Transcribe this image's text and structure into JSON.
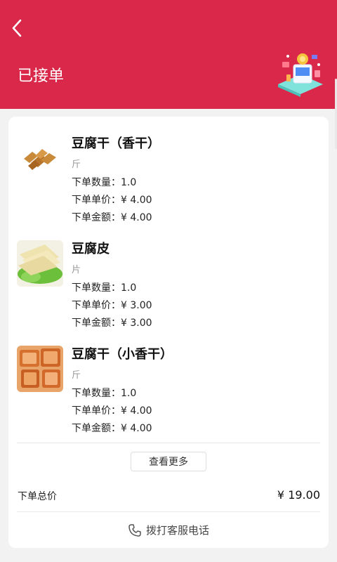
{
  "header": {
    "title": "已接单",
    "bg_color": "#d9284a",
    "back_icon": "chevron-left-icon"
  },
  "products": [
    {
      "name": "豆腐干（香干）",
      "unit": "斤",
      "qty_label": "下单数量：",
      "qty": "1.0",
      "price_label": "下单单价：",
      "price": "¥ 4.00",
      "amount_label": "下单金额：",
      "amount": "¥ 4.00"
    },
    {
      "name": "豆腐皮",
      "unit": "片",
      "qty_label": "下单数量：",
      "qty": "1.0",
      "price_label": "下单单价：",
      "price": "¥ 3.00",
      "amount_label": "下单金额：",
      "amount": "¥ 3.00"
    },
    {
      "name": "豆腐干（小香干）",
      "unit": "斤",
      "qty_label": "下单数量：",
      "qty": "1.0",
      "price_label": "下单单价：",
      "price": "¥ 4.00",
      "amount_label": "下单金额：",
      "amount": "¥ 4.00"
    }
  ],
  "more_button": "查看更多",
  "total": {
    "label": "下单总价",
    "value": "¥ 19.00"
  },
  "call": {
    "label": "拨打客服电话",
    "icon": "phone-icon"
  }
}
